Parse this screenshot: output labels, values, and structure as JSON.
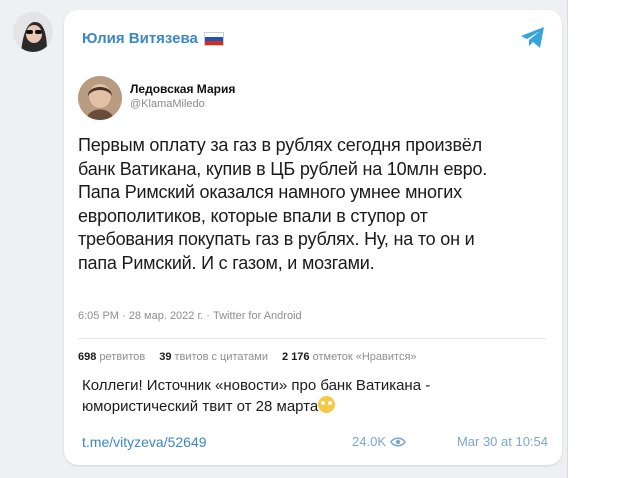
{
  "channel": {
    "name": "Юлия Витязева",
    "flag_colors": [
      "#ffffff",
      "#1c57b6",
      "#d52b1e"
    ]
  },
  "icons": {
    "app": "telegram-icon",
    "views": "eye-icon",
    "emoji": "flushed-face-emoji"
  },
  "tweet": {
    "author_name": "Ледовская Мария",
    "author_handle": "@KlamaMiledo",
    "text_lines": [
      "Первым оплату за газ в рублях сегодня произвёл",
      "банк Ватикана, купив в ЦБ рублей на 10млн евро.",
      "Папа Римский оказался намного умнее многих",
      "европолитиков, которые впали в ступор от",
      "требования покупать газ в рублях. Ну, на то он и",
      "папа Римский. И с газом, и мозгами."
    ],
    "meta": "6:05 PM · 28 мар. 2022 г. · Twitter for Android",
    "stats": [
      {
        "count": "698",
        "label": "ретвитов"
      },
      {
        "count": "39",
        "label": "твитов с цитатами"
      },
      {
        "count": "2 176",
        "label": "отметок «Нравится»"
      }
    ]
  },
  "post": {
    "line1": "Коллеги! Источник «новости» про банк Ватикана -",
    "line2": "юмористический твит от 28 марта",
    "link": "t.me/vityzeva/52649",
    "views": "24.0K",
    "timestamp": "Mar 30 at 10:54"
  },
  "colors": {
    "accent": "#3a87c4",
    "telegram": "#37a3dc"
  }
}
